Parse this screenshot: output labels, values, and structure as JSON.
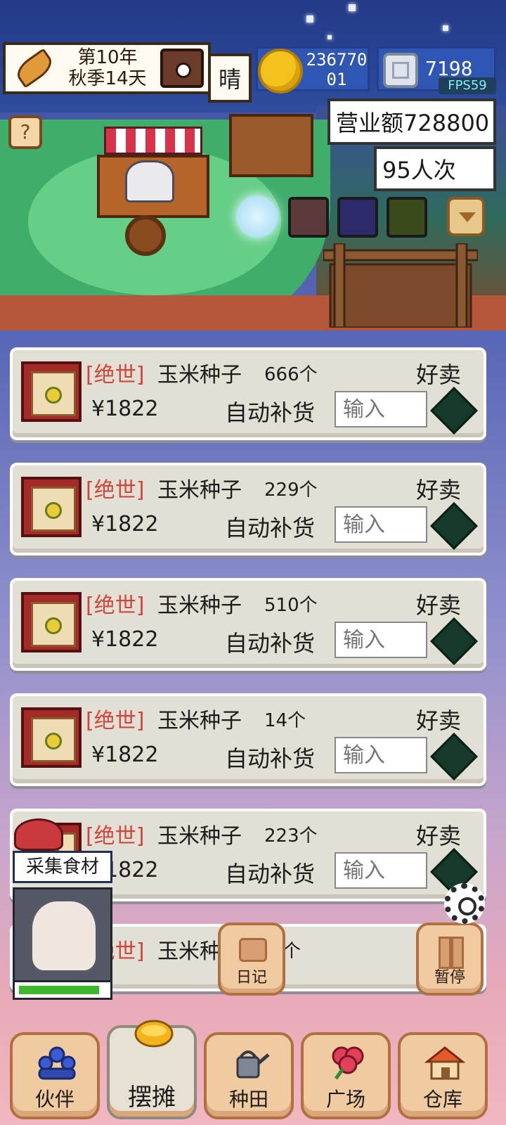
{
  "header": {
    "date_line1": "第10年",
    "date_line2": "秋季14天",
    "weather": "晴",
    "coins_line1": "236770",
    "coins_line2": "01",
    "gems": "7198",
    "fps": "FPS59"
  },
  "stats": {
    "revenue": "营业额728800",
    "visitors": "95人次"
  },
  "scene": {
    "help_label": "?"
  },
  "listings": [
    {
      "rarity": "[绝世]",
      "name": "玉米种子",
      "qty": "666个",
      "tag": "好卖",
      "price": "¥1822",
      "auto_label": "自动补货",
      "placeholder": "输入"
    },
    {
      "rarity": "[绝世]",
      "name": "玉米种子",
      "qty": "229个",
      "tag": "好卖",
      "price": "¥1822",
      "auto_label": "自动补货",
      "placeholder": "输入"
    },
    {
      "rarity": "[绝世]",
      "name": "玉米种子",
      "qty": "510个",
      "tag": "好卖",
      "price": "¥1822",
      "auto_label": "自动补货",
      "placeholder": "输入"
    },
    {
      "rarity": "[绝世]",
      "name": "玉米种子",
      "qty": "14个",
      "tag": "好卖",
      "price": "¥1822",
      "auto_label": "自动补货",
      "placeholder": "输入"
    },
    {
      "rarity": "[绝世]",
      "name": "玉米种子",
      "qty": "223个",
      "tag": "好卖",
      "price": "¥1822",
      "auto_label": "自动补货",
      "placeholder": "输入"
    },
    {
      "rarity": "[绝世]",
      "name": "玉米种",
      "qty": "个"
    }
  ],
  "partner": {
    "task": "采集食材",
    "progress": 0.92
  },
  "actions": {
    "diary": "日记",
    "pause": "暂停"
  },
  "nav": {
    "items": [
      {
        "label": "伙伴",
        "icon": "partners-icon"
      },
      {
        "label": "摆摊",
        "icon": "stall-icon",
        "active": true
      },
      {
        "label": "种田",
        "icon": "watering-can-icon"
      },
      {
        "label": "广场",
        "icon": "flower-icon"
      },
      {
        "label": "仓库",
        "icon": "house-icon"
      }
    ]
  }
}
